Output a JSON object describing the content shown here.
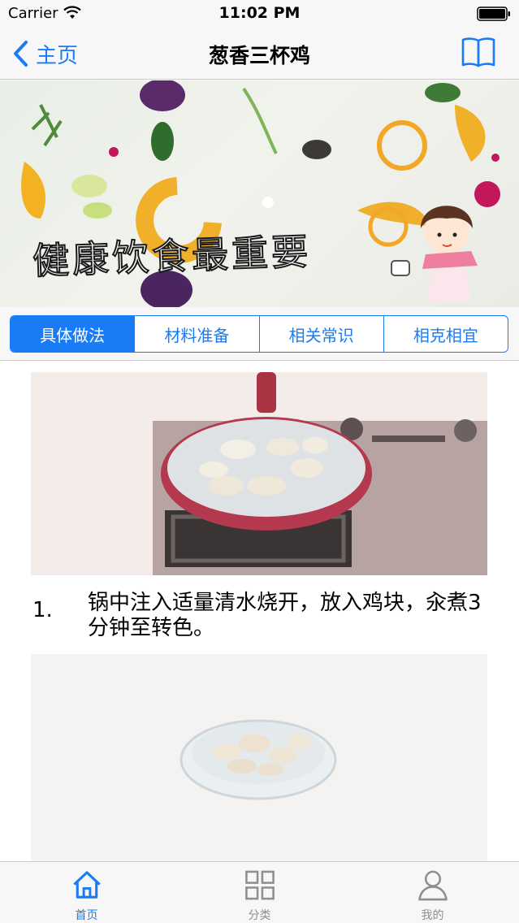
{
  "status_bar": {
    "carrier": "Carrier",
    "time": "11:02 PM",
    "wifi_icon": "wifi-icon",
    "battery_icon": "battery-icon"
  },
  "nav": {
    "back_label": "主页",
    "title": "葱香三杯鸡",
    "back_icon": "chevron-left-icon",
    "right_icon": "book-icon"
  },
  "banner": {
    "caption": "健康饮食最重要"
  },
  "segments": {
    "active_index": 0,
    "items": [
      {
        "label": "具体做法"
      },
      {
        "label": "材料准备"
      },
      {
        "label": "相关常识"
      },
      {
        "label": "相克相宜"
      }
    ]
  },
  "steps": [
    {
      "number": "1.",
      "text": "锅中注入适量清水烧开，放入鸡块，汆煮3分钟至转色。"
    }
  ],
  "tab_bar": {
    "active_index": 0,
    "items": [
      {
        "label": "首页",
        "icon": "home-icon"
      },
      {
        "label": "分类",
        "icon": "grid-icon"
      },
      {
        "label": "我的",
        "icon": "person-icon"
      }
    ]
  },
  "colors": {
    "accent": "#1a7cf5",
    "bar_background": "#f7f7f7",
    "inactive_tab": "#8e8e93"
  }
}
